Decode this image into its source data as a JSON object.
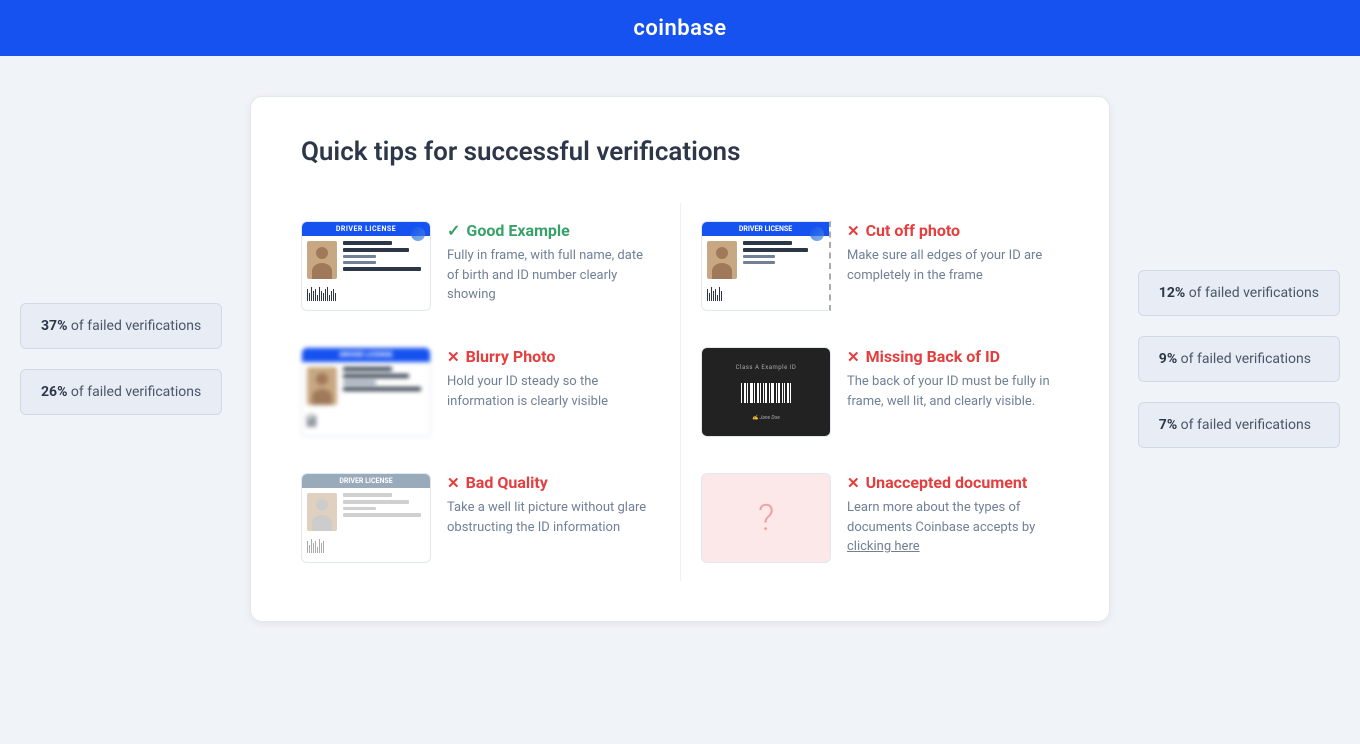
{
  "header": {
    "logo": "coinbase"
  },
  "page": {
    "title": "Quick tips for successful verifications"
  },
  "left_badges": [
    {
      "percent": "37%",
      "label": "of failed verifications"
    },
    {
      "percent": "26%",
      "label": "of failed verifications"
    }
  ],
  "right_badges": [
    {
      "percent": "12%",
      "label": "of failed verifications"
    },
    {
      "percent": "9%",
      "label": "of failed verifications"
    },
    {
      "percent": "7%",
      "label": "of failed verifications"
    }
  ],
  "tips": [
    {
      "id": "good-example",
      "icon_type": "check",
      "title": "Good Example",
      "description": "Fully in frame, with full name, date of birth and ID number clearly showing",
      "card_type": "good"
    },
    {
      "id": "cut-off-photo",
      "icon_type": "x",
      "title": "Cut off photo",
      "description": "Make sure all edges of your ID are completely in the frame",
      "card_type": "cutoff"
    },
    {
      "id": "blurry-photo",
      "icon_type": "x",
      "title": "Blurry Photo",
      "description": "Hold your ID steady so the information is clearly visible",
      "card_type": "blurry"
    },
    {
      "id": "missing-back-of-id",
      "icon_type": "x",
      "title": "Missing Back of ID",
      "description": "The back of your ID must be fully in frame, well lit, and clearly visible.",
      "card_type": "missing_back"
    },
    {
      "id": "bad-quality",
      "icon_type": "x",
      "title": "Bad Quality",
      "description": "Take a well lit picture without glare obstructing the ID information",
      "card_type": "bad_quality"
    },
    {
      "id": "unaccepted-document",
      "icon_type": "x",
      "title": "Unaccepted document",
      "description": "Learn more about the types of documents Coinbase accepts by",
      "link_text": "clicking here",
      "card_type": "unaccepted"
    }
  ]
}
